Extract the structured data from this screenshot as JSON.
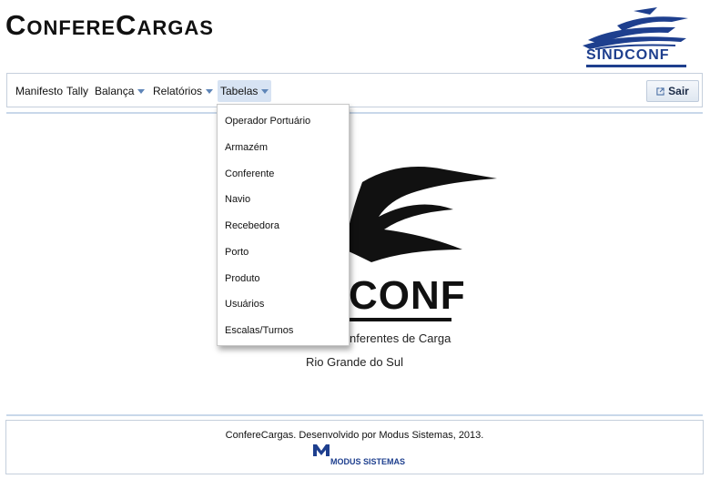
{
  "header": {
    "app_title": "ConfereCargas",
    "logo_text": "SINDCONF"
  },
  "nav": {
    "items": [
      {
        "label": "Manifesto",
        "has_caret": false
      },
      {
        "label": "Tally",
        "has_caret": false
      },
      {
        "label": "Balança",
        "has_caret": true
      },
      {
        "label": "Relatórios",
        "has_caret": true
      },
      {
        "label": "Tabelas",
        "has_caret": true,
        "active": true
      }
    ],
    "logout_label": "Sair",
    "logout_icon": "external-link-icon"
  },
  "dropdown": {
    "items": [
      "Operador Portuário",
      "Armazém",
      "Conferente",
      "Navio",
      "Recebedora",
      "Porto",
      "Produto",
      "Usuários",
      "Escalas/Turnos"
    ]
  },
  "main": {
    "logo_text": "CONF",
    "subtitle_line1": "nferentes de Carga",
    "subtitle_line2": "Rio Grande do Sul"
  },
  "footer": {
    "text": "ConfereCargas. Desenvolvido por Modus Sistemas, 2013.",
    "modus_logo_text": "MODUS SISTEMAS"
  },
  "colors": {
    "brand_blue": "#1e3f8e",
    "active_tab_bg": "#d7e3f3",
    "rule": "#c9d8ea"
  }
}
